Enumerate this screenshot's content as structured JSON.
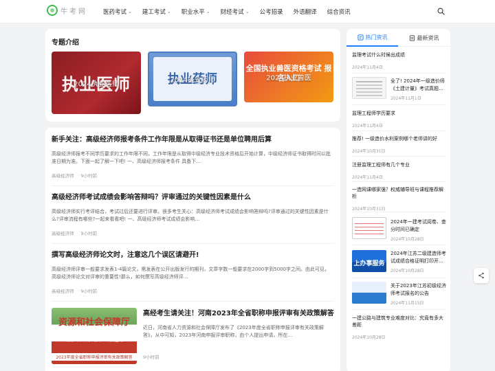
{
  "header": {
    "logo_text": "牛考网",
    "nav": [
      {
        "label": "医药考试",
        "has_menu": true
      },
      {
        "label": "建工考试",
        "has_menu": true
      },
      {
        "label": "职业水平",
        "has_menu": true
      },
      {
        "label": "财经考试",
        "has_menu": true
      },
      {
        "label": "公考招录",
        "has_menu": false
      },
      {
        "label": "外语翻译",
        "has_menu": false
      },
      {
        "label": "综合资讯",
        "has_menu": false
      }
    ]
  },
  "topics": {
    "title": "专题介绍",
    "cards": [
      {
        "label": "2024执业医师",
        "art": "执业医师"
      },
      {
        "label": "2024执业药师",
        "art": "执业药师"
      },
      {
        "label": "2024执业兽医",
        "art": "全国执业兽医资格考试 报名入口"
      }
    ]
  },
  "articles": [
    {
      "title": "新手关注：高级经济师报考条件工作年限是从取得证书还是单位聘用后算",
      "desc": "高级经济师报考不同学历要求的工作年限不同，工作年限是从取得中级经济专业技术资格后开始计算，中级经济师证书取得时间以批准日期为准。下面一起了解一下吧! 一、高级经济师报考条件 具备下…",
      "author": "高级经济师",
      "time": "9小时前"
    },
    {
      "title": "高级经济师考试成绩会影响答辩吗？评审通过的关键性因素是什么",
      "desc": "高级经济师实行考评结合，考试过后还要进行评审。很多考生关心：高级经济师考试成绩会影响答辩吗?评审通过的关键性因素是什么?评审流程有哪些?一起来看看吧! 一、高级经济师考试成绩会影响…",
      "author": "高级经济师",
      "time": "9小时前"
    },
    {
      "title": "撰写高级经济师论文时，注意这几个误区请避开!",
      "desc": "高级经济师评审一般要求发表1-4篇论文，需发表在公开出版发行的期刊，文章字数一般要求在2000字到5000字之间。由此可见，高级经济师论文对评审的重要性!那么，如何撰写高级经济师评…",
      "author": "高级经济师",
      "time": "9小时前"
    },
    {
      "title": "高经考生请关注！河南2023年全省职称申报评审有关政策解答",
      "desc": "近日，河南省人力资源和社会保障厅发布了《2023年度全省职称申报评审有关政策解答》，从中可知，2023年河南申报评审职称，由个人提出申请，所在…",
      "author": "",
      "time": "9小时前",
      "image": {
        "heading": "资源和社会保障厅",
        "links": "政务公开　网上办事　政民互动",
        "caption": "2023年度全省职称申报评审有关政策解答"
      }
    }
  ],
  "sidebar": {
    "tabs": [
      {
        "label": "热门资讯",
        "active": true
      },
      {
        "label": "最新资讯",
        "active": false
      }
    ],
    "items": [
      {
        "title": "监理考试什么时候出成绩",
        "date": "2024年11月4日",
        "image": null
      },
      {
        "title": "全了! 2024年一级造价师《土建计量》考试真题…",
        "date": "2024年11月1日",
        "image": "doc"
      },
      {
        "title": "监理工程师学历要求",
        "date": "2024年11月4日",
        "image": null
      },
      {
        "title": "推荐! 一级造价水利案例哪个老师讲的好",
        "date": "2024年10月31日",
        "image": null
      },
      {
        "title": "注册监理工程师有几个专业",
        "date": "2024年11月4日",
        "image": null
      },
      {
        "title": "一造网课哪家强？权威辅导班与课程推荐解析",
        "date": "2024年10月31日",
        "image": null
      },
      {
        "title": "2024年一建考试阅卷、查分时间已确定",
        "date": "2024年10月28日",
        "image": "table"
      },
      {
        "title": "2024年江苏二级建造师考试成绩合格证明打印开…",
        "date": "2024年10月28日",
        "image": "blue",
        "image_text": "上办事服务"
      },
      {
        "title": "关于2023年江苏初级经济师考试报名的公告",
        "date": "2024年11月15日",
        "image": "gov"
      },
      {
        "title": "一建公路与建筑专业难度对比：究竟有多大差距",
        "date": "2024年10月28日",
        "image": null
      }
    ]
  }
}
